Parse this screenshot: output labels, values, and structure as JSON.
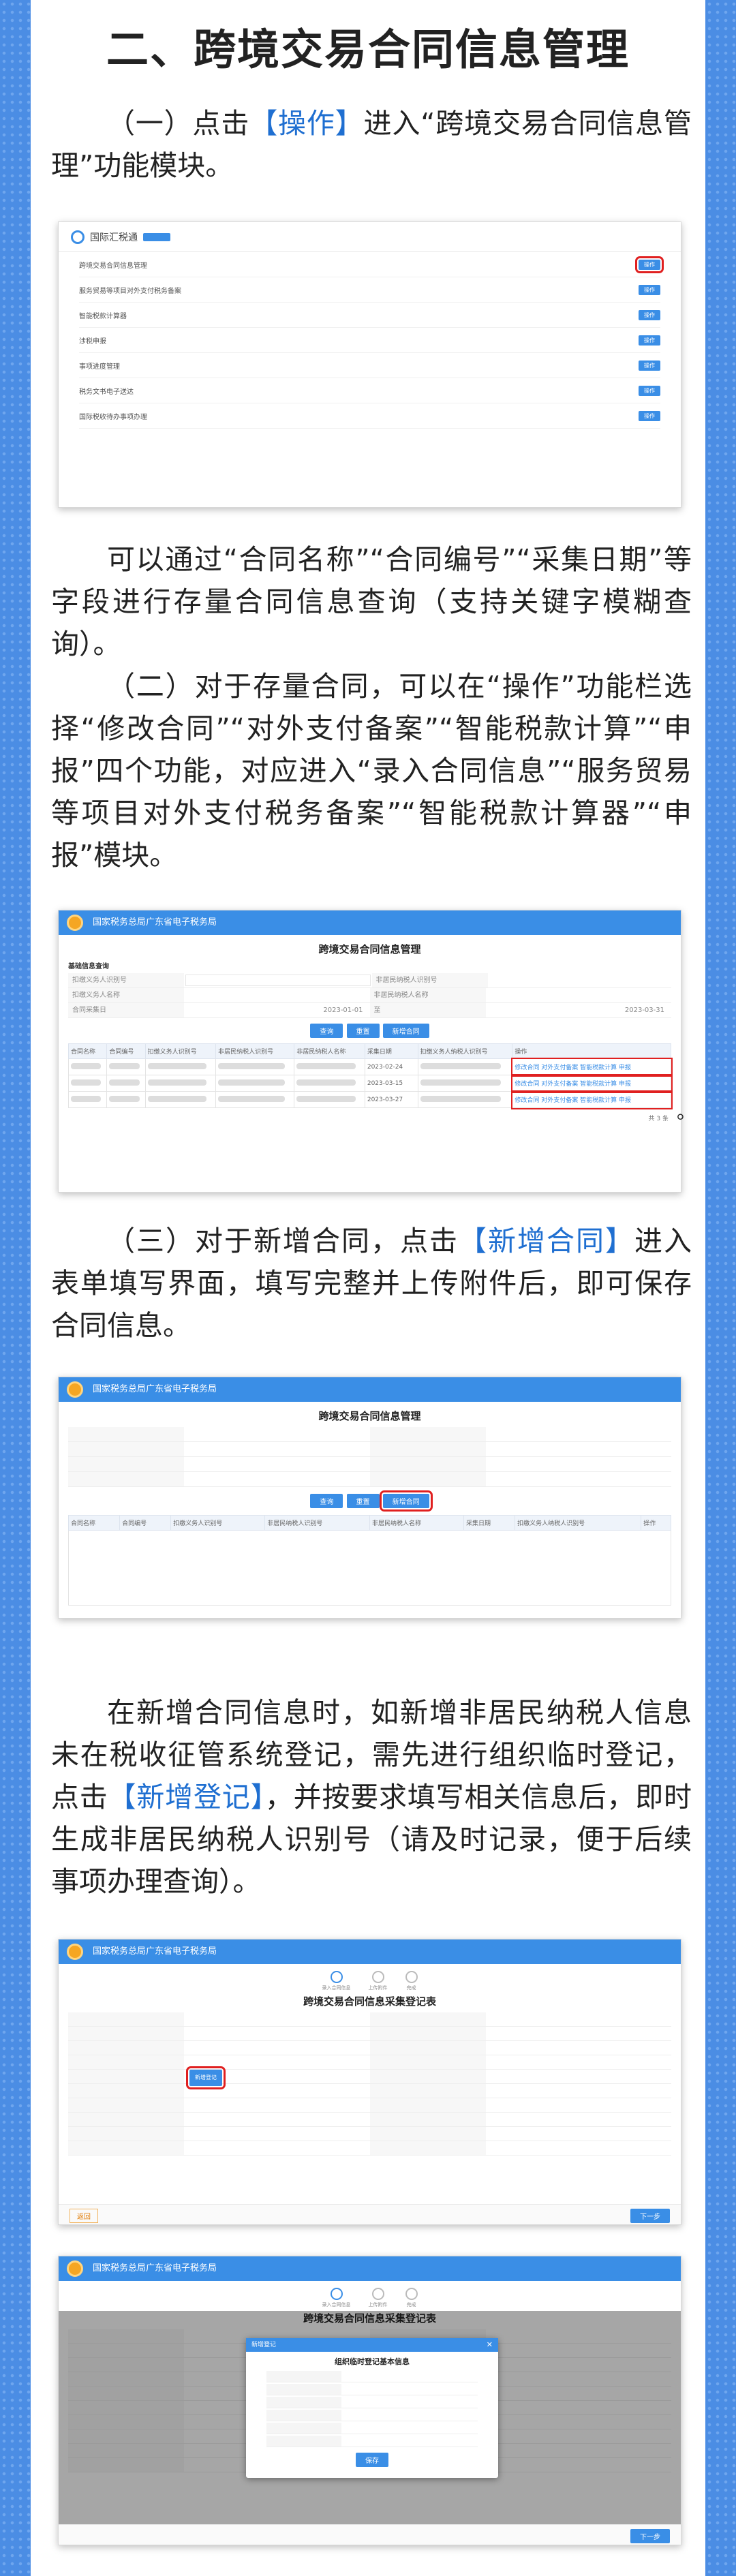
{
  "heading": "二、跨境交易合同信息管理",
  "p1": {
    "pre": "（一）点击",
    "hl": "【操作】",
    "post": "进入“跨境交易合同信息管理”功能模块。"
  },
  "p2": "可以通过“合同名称”“合同编号”“采集日期”等字段进行存量合同信息查询（支持关键字模糊查询）。",
  "p3": "（二）对于存量合同，可以在“操作”功能栏选择“修改合同”“对外支付备案”“智能税款计算”“申报”四个功能，对应进入“录入合同信息”“服务贸易等项目对外支付税务备案”“智能税款计算器”“申报”模块。",
  "p4": {
    "pre": "（三）对于新增合同，点击",
    "hl": "【新增合同】",
    "post": "进入表单填写界面，填写完整并上传附件后，即可保存合同信息。"
  },
  "p5": {
    "pre": "在新增合同信息时，如新增非居民纳税人信息未在税收征管系统登记，需先进行组织临时登记，点击",
    "hl": "【新增登记】",
    "post": "，并按要求填写相关信息后，即时生成非居民纳税人识别号（请及时记录，便于后续事项办理查询）。"
  },
  "stray_mark": "。",
  "shot1": {
    "app_name": "国际汇税通",
    "badge": "",
    "items": [
      {
        "label": "跨境交易合同信息管理",
        "btn": "操作"
      },
      {
        "label": "服务贸易等项目对外支付税务备案",
        "btn": "操作"
      },
      {
        "label": "智能税款计算器",
        "btn": "操作"
      },
      {
        "label": "涉税申报",
        "btn": "操作"
      },
      {
        "label": "事项进度管理",
        "btn": "操作"
      },
      {
        "label": "税务文书电子送达",
        "btn": "操作"
      },
      {
        "label": "国际税收待办事项办理",
        "btn": "操作"
      }
    ]
  },
  "shot2": {
    "nav": "国家税务总局广东省电子税务局",
    "title": "跨境交易合同信息管理",
    "section": "基础信息查询",
    "fields": [
      "扣缴义务人识别号",
      "非居民纳税人识别号",
      "扣缴义务人名称",
      "非居民纳税人名称",
      "合同采集日",
      "至"
    ],
    "dates": [
      "2023-01-01",
      "2023-03-31"
    ],
    "buttons": [
      "查询",
      "重置",
      "新增合同"
    ],
    "columns": [
      "合同名称",
      "合同编号",
      "扣缴义务人识别号",
      "非居民纳税人识别号",
      "非居民纳税人名称",
      "采集日期",
      "扣缴义务人纳税人识别号",
      "操作"
    ],
    "rows": [
      {
        "name": "",
        "date": "2023-02-24"
      },
      {
        "name": "",
        "date": "2023-03-15"
      },
      {
        "name": "",
        "date": "2023-03-27"
      }
    ],
    "ops": "修改合同  对外支付备案  智能税款计算  申报",
    "pager": "共 3 条"
  },
  "shot3": {
    "nav": "国家税务总局广东省电子税务局",
    "title": "跨境交易合同信息管理",
    "buttons": [
      "查询",
      "重置",
      "新增合同"
    ]
  },
  "shot4": {
    "nav": "国家税务总局广东省电子税务局",
    "title": "跨境交易合同信息采集登记表",
    "steps": [
      "录入合同信息",
      "上传附件",
      "完成"
    ],
    "register_btn": "新增登记",
    "footer_left": "返回",
    "footer_right": "下一步"
  },
  "shot5": {
    "nav": "国家税务总局广东省电子税务局",
    "title": "跨境交易合同信息采集登记表",
    "modal_head": "新增登记",
    "modal_title": "组织临时登记基本信息",
    "modal_btn": "保存",
    "footer_right": "下一步"
  }
}
